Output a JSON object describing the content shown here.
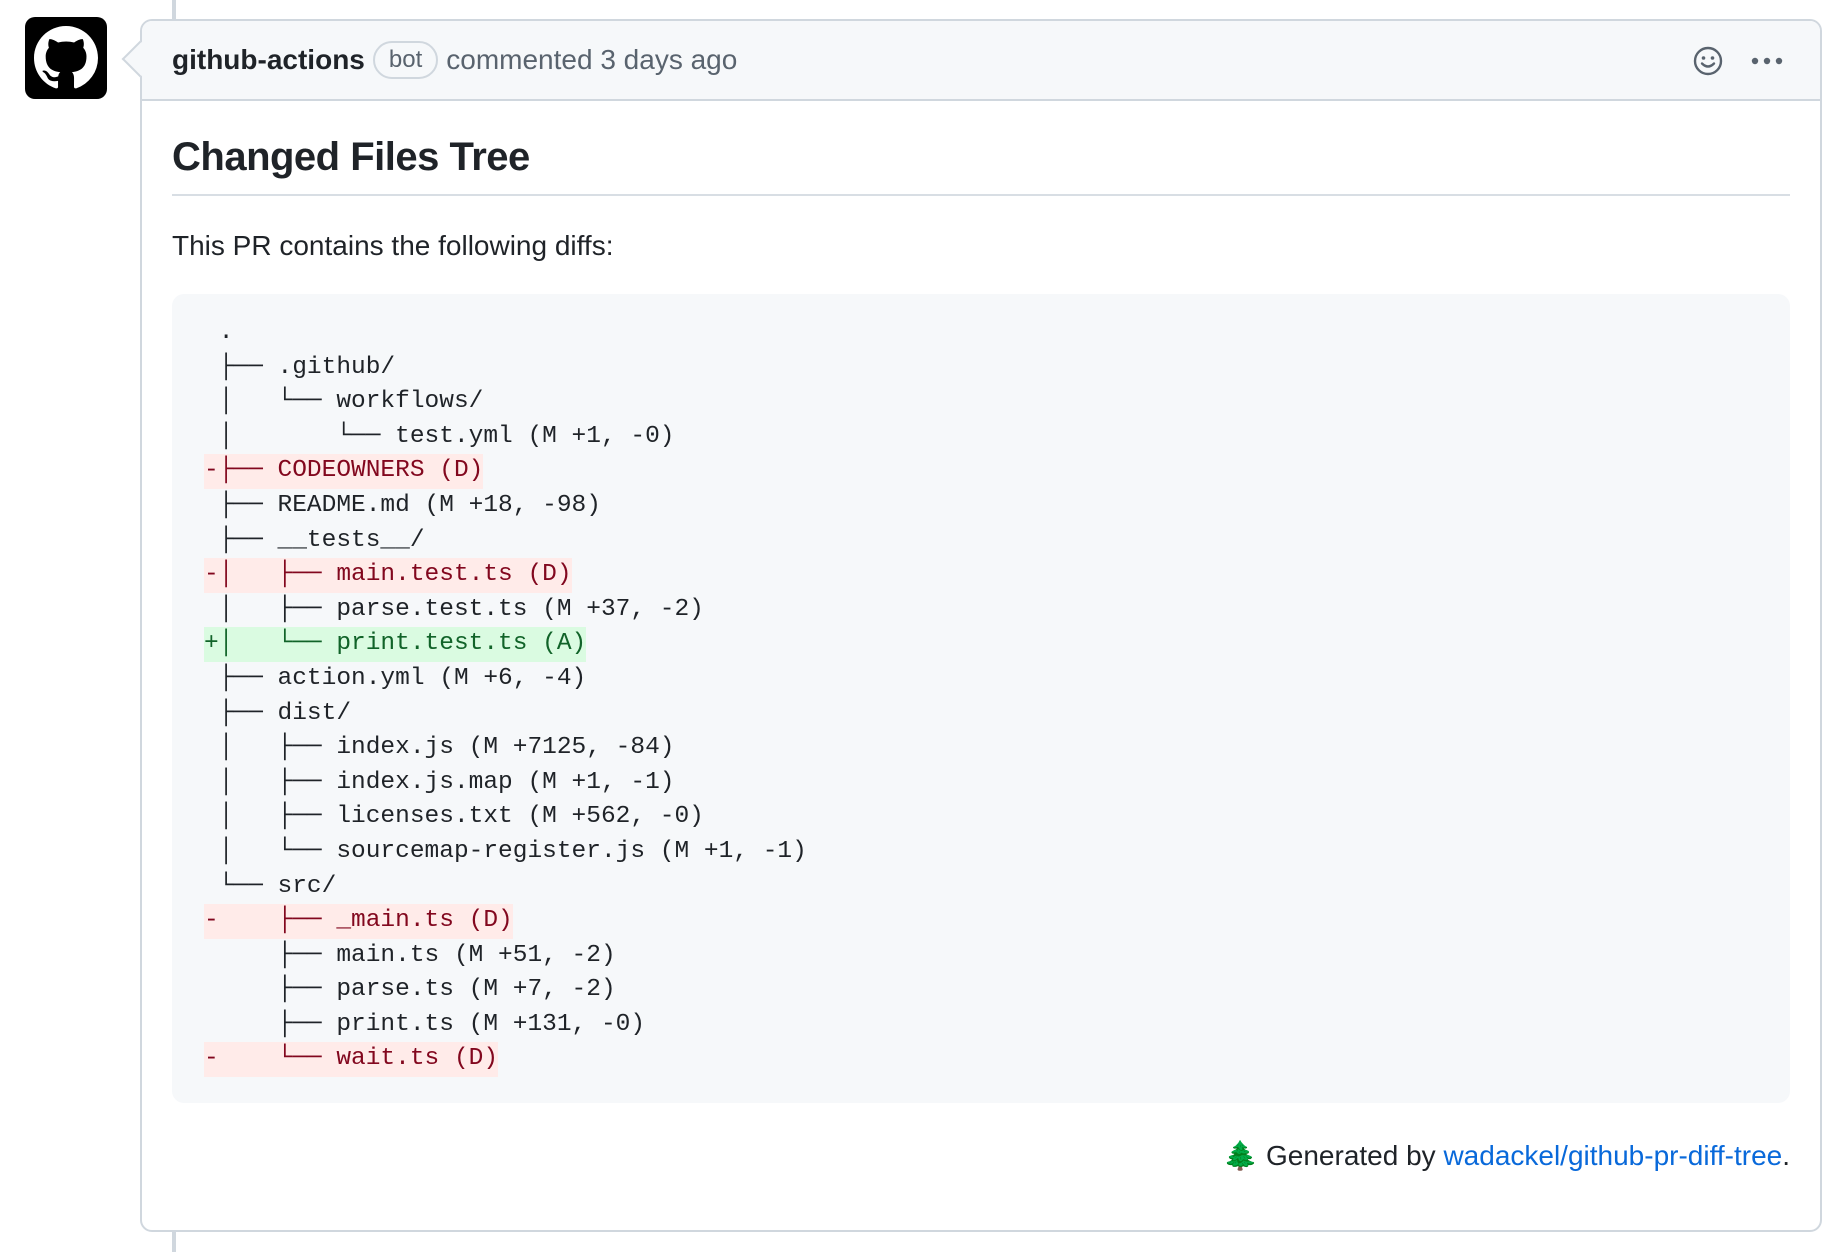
{
  "comment": {
    "author": "github-actions",
    "badge": "bot",
    "meta": "commented 3 days ago",
    "title": "Changed Files Tree",
    "intro": "This PR contains the following diffs:",
    "tree_lines": [
      {
        "text": " .",
        "type": "normal"
      },
      {
        "text": " ├── .github/",
        "type": "normal"
      },
      {
        "text": " │   └── workflows/",
        "type": "normal"
      },
      {
        "text": " │       └── test.yml (M +1, -0)",
        "type": "normal"
      },
      {
        "text": "-├── CODEOWNERS (D)",
        "type": "del"
      },
      {
        "text": " ├── README.md (M +18, -98)",
        "type": "normal"
      },
      {
        "text": " ├── __tests__/",
        "type": "normal"
      },
      {
        "text": "-│   ├── main.test.ts (D)",
        "type": "del"
      },
      {
        "text": " │   ├── parse.test.ts (M +37, -2)",
        "type": "normal"
      },
      {
        "text": "+│   └── print.test.ts (A)",
        "type": "add"
      },
      {
        "text": " ├── action.yml (M +6, -4)",
        "type": "normal"
      },
      {
        "text": " ├── dist/",
        "type": "normal"
      },
      {
        "text": " │   ├── index.js (M +7125, -84)",
        "type": "normal"
      },
      {
        "text": " │   ├── index.js.map (M +1, -1)",
        "type": "normal"
      },
      {
        "text": " │   ├── licenses.txt (M +562, -0)",
        "type": "normal"
      },
      {
        "text": " │   └── sourcemap-register.js (M +1, -1)",
        "type": "normal"
      },
      {
        "text": " └── src/",
        "type": "normal"
      },
      {
        "text": "-    ├── _main.ts (D)",
        "type": "del"
      },
      {
        "text": "     ├── main.ts (M +51, -2)",
        "type": "normal"
      },
      {
        "text": "     ├── parse.ts (M +7, -2)",
        "type": "normal"
      },
      {
        "text": "     ├── print.ts (M +131, -0)",
        "type": "normal"
      },
      {
        "text": "-    └── wait.ts (D)",
        "type": "del"
      }
    ],
    "footer": {
      "emoji": "🌲",
      "prefix": "Generated by",
      "link_text": "wadackel/github-pr-diff-tree",
      "suffix": "."
    }
  },
  "icons": {
    "avatar": "github-mark-icon",
    "reaction": "smiley-icon",
    "more": "kebab-horizontal-icon"
  },
  "colors": {
    "link": "#0969da",
    "deletion_bg": "#ffebe9",
    "deletion_fg": "#82071e",
    "addition_bg": "#dafbe1",
    "addition_fg": "#116329"
  }
}
